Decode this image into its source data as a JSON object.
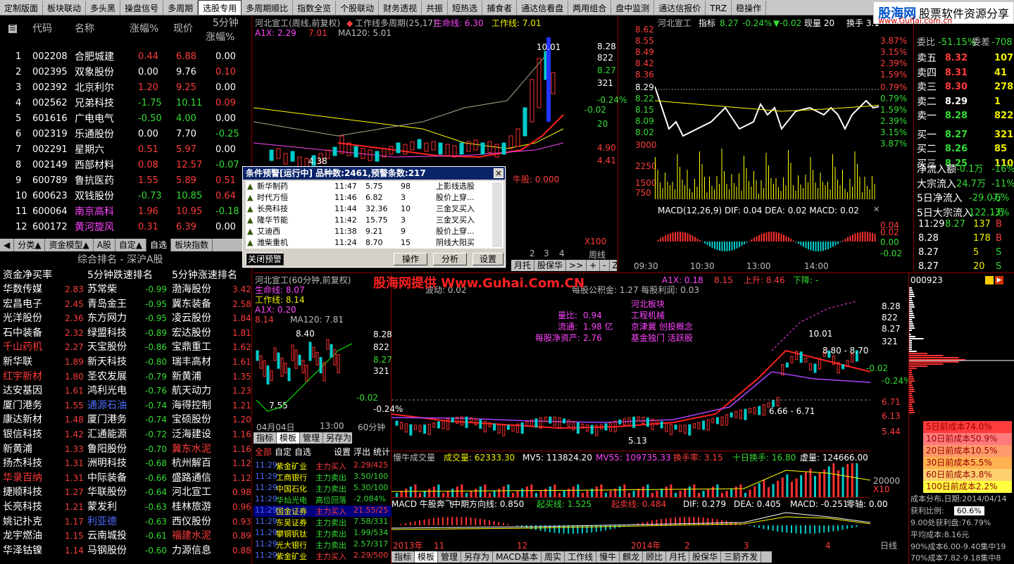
{
  "toolbar": {
    "tabs": [
      "定制版面",
      "板块联动",
      "多头黑",
      "操盘信号",
      "多周期",
      "选股专用",
      "多周期顺比",
      "指数全览",
      "个股联动",
      "财务透视",
      "共振",
      "短热选",
      "捕食者",
      "通达信看盘",
      "两用组合",
      "盘中监测",
      "通达信报价",
      "TRZ",
      "稳操作"
    ],
    "selected": 5
  },
  "watermark": {
    "brand": "股海网",
    "slogan": "股票软件资源分享",
    "url": "www.Guhai.com.cn"
  },
  "stocklist": {
    "headers": [
      "代码",
      "名称",
      "涨幅%",
      "现价",
      "5分钟",
      "涨幅%"
    ],
    "rows": [
      {
        "n": "1",
        "code": "002208",
        "name": "合肥城建",
        "chg": "0.44",
        "price": "6.88",
        "m5": "0.00",
        "c": "red"
      },
      {
        "n": "2",
        "code": "002395",
        "name": "双象股份",
        "chg": "0.00",
        "price": "9.76",
        "m5": "0.10",
        "c": "wht"
      },
      {
        "n": "3",
        "code": "002392",
        "name": "北京利尔",
        "chg": "1.20",
        "price": "9.25",
        "m5": "0.00",
        "c": "red"
      },
      {
        "n": "4",
        "code": "002562",
        "name": "兄弟科技",
        "chg": "-1.75",
        "price": "10.11",
        "m5": "0.09",
        "c": "grn"
      },
      {
        "n": "5",
        "code": "601616",
        "name": "广电电气",
        "chg": "-0.50",
        "price": "4.00",
        "m5": "0.00",
        "c": "grn"
      },
      {
        "n": "6",
        "code": "002319",
        "name": "乐通股份",
        "chg": "0.00",
        "price": "7.70",
        "m5": "-0.25",
        "c": "wht"
      },
      {
        "n": "7",
        "code": "002291",
        "name": "星期六",
        "chg": "0.51",
        "price": "5.97",
        "m5": "0.00",
        "c": "red"
      },
      {
        "n": "8",
        "code": "002149",
        "name": "西部材料",
        "chg": "0.08",
        "price": "12.57",
        "m5": "-0.07",
        "c": "red"
      },
      {
        "n": "9",
        "code": "600789",
        "name": "鲁抗医药",
        "chg": "1.55",
        "price": "5.89",
        "m5": "0.51",
        "c": "red"
      },
      {
        "n": "10",
        "code": "600623",
        "name": "双钱股份",
        "chg": "-0.73",
        "price": "10.85",
        "m5": "0.64",
        "c": "grn"
      },
      {
        "n": "11",
        "code": "600064",
        "name": "南京高科",
        "chg": "1.96",
        "price": "10.95",
        "m5": "-0.18",
        "c": "red"
      },
      {
        "n": "12",
        "code": "600172",
        "name": "黄河旋风",
        "chg": "0.31",
        "price": "6.39",
        "m5": "0.00",
        "c": "red"
      }
    ],
    "tabs": [
      "分类▲",
      "资金模型▲",
      "A股",
      "自定▲",
      "自选",
      "板块指数"
    ],
    "sel_tab": 4
  },
  "ranking": {
    "title": "综合排名 - 深沪A股",
    "cols": [
      "资金净买率",
      "5分钟跌速排名",
      "5分钟涨速排名"
    ],
    "c1": [
      [
        "华数传媒",
        "2.83"
      ],
      [
        "宏昌电子",
        "2.45"
      ],
      [
        "光洋股份",
        "2.36"
      ],
      [
        "石中装备",
        "2.32"
      ],
      [
        "千山药机",
        "2.27"
      ],
      [
        "新华联",
        "1.89"
      ],
      [
        "红宇新材",
        "1.80"
      ],
      [
        "达安基因",
        "1.61"
      ],
      [
        "厦门港务",
        "1.55"
      ],
      [
        "康达新材",
        "1.48"
      ],
      [
        "银信科技",
        "1.42"
      ],
      [
        "新黄浦",
        "1.33"
      ],
      [
        "扬杰科技",
        "1.31"
      ],
      [
        "华录百纳",
        "1.31"
      ],
      [
        "捷顺科技",
        "1.27"
      ],
      [
        "长亮科技",
        "1.21"
      ],
      [
        "姚记扑克",
        "1.17"
      ],
      [
        "龙宇燃油",
        "1.15"
      ],
      [
        "华泽钴镍",
        "1.14"
      ]
    ],
    "c2": [
      [
        "苏常柴",
        "-0.99"
      ],
      [
        "青岛金王",
        "-0.95"
      ],
      [
        "东方网力",
        "-0.95"
      ],
      [
        "绿盟科技",
        "-0.89"
      ],
      [
        "天宝股份",
        "-0.86"
      ],
      [
        "新天科技",
        "-0.80"
      ],
      [
        "圣农发展",
        "-0.79"
      ],
      [
        "鸿利光电",
        "-0.76"
      ],
      [
        "通源石油",
        "-0.74"
      ],
      [
        "厦门港务",
        "-0.74"
      ],
      [
        "汇通能源",
        "-0.72"
      ],
      [
        "鲁阳股份",
        "-0.70"
      ],
      [
        "洲明科技",
        "-0.68"
      ],
      [
        "中际装备",
        "-0.66"
      ],
      [
        "华联股份",
        "-0.64"
      ],
      [
        "蒙发利",
        "-0.63"
      ],
      [
        "利亚德",
        "-0.63"
      ],
      [
        "云南城投",
        "-0.61"
      ],
      [
        "马钢股份",
        "-0.60"
      ]
    ],
    "c3": [
      [
        "渤海股份",
        "3.42"
      ],
      [
        "冀东装备",
        "2.58"
      ],
      [
        "凌云股份",
        "1.84"
      ],
      [
        "宏达股份",
        "1.81"
      ],
      [
        "宝鼎重工",
        "1.62"
      ],
      [
        "瑞丰高材",
        "1.61"
      ],
      [
        "新黄浦",
        "1.35"
      ],
      [
        "航天动力",
        "1.23"
      ],
      [
        "海得控制",
        "1.21"
      ],
      [
        "宝硕股份",
        "1.20"
      ],
      [
        "泛海建设",
        "1.16"
      ],
      [
        "冀东水泥",
        "1.16"
      ],
      [
        "杭州解百",
        "1.12"
      ],
      [
        "盛路通信",
        "1.12"
      ],
      [
        "河北宣工",
        "0.98"
      ],
      [
        "桂林旅游",
        "0.96"
      ],
      [
        "西仪股份",
        "0.93"
      ],
      [
        "福建水泥",
        "0.89"
      ],
      [
        "力源信息",
        "0.88"
      ]
    ]
  },
  "weekly": {
    "title": "河北宣工(周线,前复权)",
    "sub": "工作线多周期(25,17)",
    "life": "生命线: 6.30",
    "work": "工作线: 7.01",
    "a1x": "A1X: 2.29",
    "v701": "7.01",
    "ma120": "MA120: 5.01",
    "high": "10.01",
    "low": "4.38",
    "ticks": [
      "8.28",
      "822",
      "8.27",
      "321",
      "-0.24%",
      "20",
      "4.90",
      "4.41"
    ],
    "dn": "-0.02",
    "x100": "X100",
    "period": "周线",
    "btm": [
      "月托",
      "股保华",
      ">>",
      "+",
      "-",
      "Z"
    ],
    "ax": [
      "2",
      "3",
      "4"
    ],
    "niu": "牛股: 0.000"
  },
  "popup": {
    "title": "条件预警[运行中] 品种数:2461,预警条数:217",
    "rows": [
      [
        "新华制药",
        "11:47",
        "5.75",
        "98",
        "上影线选股"
      ],
      [
        "时代万恒",
        "11:46",
        "6.82",
        "3",
        "股价上穿..."
      ],
      [
        "长亮科技",
        "11:44",
        "32.36",
        "10",
        "三金叉买入"
      ],
      [
        "隆华节能",
        "11:42",
        "15.75",
        "3",
        "三金叉买入"
      ],
      [
        "艾迪西",
        "11:38",
        "9.21",
        "9",
        "股价上穿..."
      ],
      [
        "潍柴重机",
        "11:24",
        "8.70",
        "15",
        "阴线大阳买"
      ]
    ],
    "close": "关闭预警",
    "buttons": [
      "操作",
      "分析",
      "设置"
    ]
  },
  "intraday": {
    "name": "河北宣工",
    "ind": "指标",
    "price": "8.27",
    "pct": "-0.24%",
    "chg": "▼-0.02",
    "vol": "现量 20",
    "turn": "换手 3.1",
    "ticks": [
      "8.62",
      "8.55",
      "8.49",
      "8.42",
      "8.36",
      "8.29",
      "8.22",
      "8.15",
      "8.09",
      "8.02",
      "3000",
      "2250",
      "1500",
      "750"
    ],
    "rticks": [
      "3.87%",
      "3.15%",
      "2.39%",
      "1.59%",
      "0.79%",
      "0.79%",
      "1.59%",
      "2.39%",
      "3.15%",
      "3.87%"
    ],
    "macd": "MACD(12,26,9)  DIF: 0.04  DEA: 0.02  MACD: 0.02",
    "times": [
      "09:30",
      "10:30",
      "13:00",
      "14:00"
    ],
    "mt": [
      "0.04",
      "0.02",
      "0.00",
      "-0.02"
    ]
  },
  "orderbook": {
    "wb": "委比",
    "wb_v": "-51.15%",
    "wc": "委差",
    "wc_v": "-708",
    "sells": [
      [
        "卖五",
        "8.32",
        "107"
      ],
      [
        "卖四",
        "8.31",
        "41"
      ],
      [
        "卖三",
        "8.30",
        "278"
      ],
      [
        "卖二",
        "8.29",
        "1"
      ],
      [
        "卖一",
        "8.28",
        "822"
      ]
    ],
    "buys": [
      [
        "买一",
        "8.27",
        "321"
      ],
      [
        "买二",
        "8.26",
        "85"
      ],
      [
        "买三",
        "8.25",
        "110"
      ]
    ],
    "flows": [
      [
        "净流入额",
        "-0.1万",
        "-16%"
      ],
      [
        "大宗流入",
        "24.7万",
        "-11%"
      ],
      [
        "5日净流入",
        "-29.0万",
        "-6%"
      ],
      [
        "5日大宗流入",
        "122.1万",
        "-3%"
      ]
    ],
    "ticks": [
      [
        "11:29",
        "8.27",
        "137",
        "B"
      ],
      [
        "8.28",
        "",
        "178",
        "B"
      ],
      [
        "8.27",
        "",
        "5",
        "S"
      ],
      [
        "8.27",
        "",
        "20",
        "S"
      ]
    ]
  },
  "min60": {
    "title": "河北宣工(60分钟,前复权)",
    "life": "生命线: 8.07",
    "work": "工作线: 8.14",
    "a1x": "A1X: 0.20",
    "v814": "8.14",
    "ma120": "MA120: 7.81",
    "hi": "8.40",
    "lo": "7.55",
    "ticks": [
      "8.28",
      "822",
      "8.27",
      "321",
      "-0.02",
      "-0.24%"
    ],
    "date": "04月04日",
    "time": "13:00",
    "period": "60分钟",
    "tabs": [
      "指标",
      "模板",
      "管理",
      "另存为"
    ]
  },
  "monitor": {
    "tabs": [
      "全部",
      "自定",
      "自选"
    ],
    "tools": [
      "设置",
      "浮出",
      "统计"
    ],
    "rows": [
      [
        "11:29",
        "紫金矿业",
        "主力买入",
        "2.29/425"
      ],
      [
        "11:29",
        "工商银行",
        "主力卖出",
        "3.50/100"
      ],
      [
        "11:29",
        "中国石化",
        "主力卖出",
        "5.30/100"
      ],
      [
        "11:29",
        "华灿光电",
        "高位回落",
        "-2.084%"
      ],
      [
        "11:29",
        "国金证券",
        "主力买入",
        "21.55/25"
      ],
      [
        "11:29",
        "东吴证券",
        "主力卖出",
        "7.58/331"
      ],
      [
        "11:29",
        "攀钢钒钛",
        "主力卖出",
        "1.99/534"
      ],
      [
        "11:29",
        "光大银行",
        "主力卖出",
        "2.57/317"
      ],
      [
        "11:29",
        "紫金矿业",
        "主力买入",
        "2.29/500"
      ]
    ]
  },
  "daily": {
    "top": "每股公积金: 1.27   每股利润: 0.03",
    "a1x": "A1X: 0.18",
    "v815": "8.15",
    "up": "上升: 8.46",
    "down": "下降: -",
    "bk": "河北板块",
    "gc": "工程机械",
    "lb": "量比:",
    "lb_v": "0.94",
    "lt": "流通:",
    "lt_v": "1.98 亿",
    "jj": "京津冀 创投概念",
    "jz": "每股净资产:",
    "jz_v": "2.76",
    "jj2": "基金独门 活跃股",
    "hi": "10.01",
    "r1": "8.80 - 8.70",
    "r2": "6.66 - 6.71",
    "lo": "5.13",
    "bd": "波动: 0.02",
    "ticks": [
      "8.28",
      "822",
      "8.27",
      "321",
      "-0.02",
      "-0.24%",
      "6.71",
      "6.13",
      "5.44"
    ],
    "volbar": {
      "title": "慢牛成交量",
      "vol": "成交量: 62333.30",
      "mv5": "MV5: 113824.20",
      "mv55": "MV55: 109735.33",
      "turn": "换手率: 3.15",
      "ten": "十日换手: 16.80",
      "cur": "虚量: 124666.00",
      "t": "20000",
      "x": "X10"
    },
    "macd": {
      "t": "MACD 牛股奔飞",
      "mid": "中期方向线: 0.850",
      "up": "起买线: 1.525",
      "dn": "起卖线: 0.484",
      "dif": "DIF: 0.279",
      "dea": "DEA: 0.405",
      "m": "MACD: -0.251",
      "z": "零轴: 0.00"
    },
    "xax": [
      "2013年",
      "11",
      "12",
      "2014年",
      "2",
      "3",
      "4"
    ],
    "period": "日线",
    "btm": [
      "指标",
      "模板",
      "管理",
      "另存为",
      "MACD基本",
      "周实",
      "工作线",
      "慢牛",
      "麒龙",
      "顾比",
      "月托",
      "股保华",
      "三箭齐发"
    ]
  },
  "dist": {
    "code": "000923",
    "legend": [
      [
        "5日前成本74.0%",
        "#ff3c3c"
      ],
      [
        "10日前成本50.9%",
        "#ff7a7a"
      ],
      [
        "20日前成本10.5%",
        "#ff9a6a"
      ],
      [
        "30日前成本5.5%",
        "#ffb050"
      ],
      [
        "60日前成本3.8%",
        "#ffd070"
      ],
      [
        "100日前成本2.2%",
        "#ffff40"
      ]
    ],
    "date": "成本分布,日期:",
    "date_v": "2014/04/14",
    "profit": "获利比例:",
    "profit_v": "60.6%",
    "p900": "9.00处获利盘:",
    "p900_v": "76.79%",
    "avg": "平均成本:",
    "avg_v": "8.16元",
    "c90": "90%成本6.00-9.40集中19",
    "c70": "70%成本7.82-9.18集中8"
  },
  "banner": "股海网提供 Www.Guhai.Com.CN",
  "colors": {
    "up": "#ff3c3c",
    "down": "#33dd33",
    "ma": "#ffff00",
    "bg": "#000000",
    "frame": "#8a0000"
  }
}
